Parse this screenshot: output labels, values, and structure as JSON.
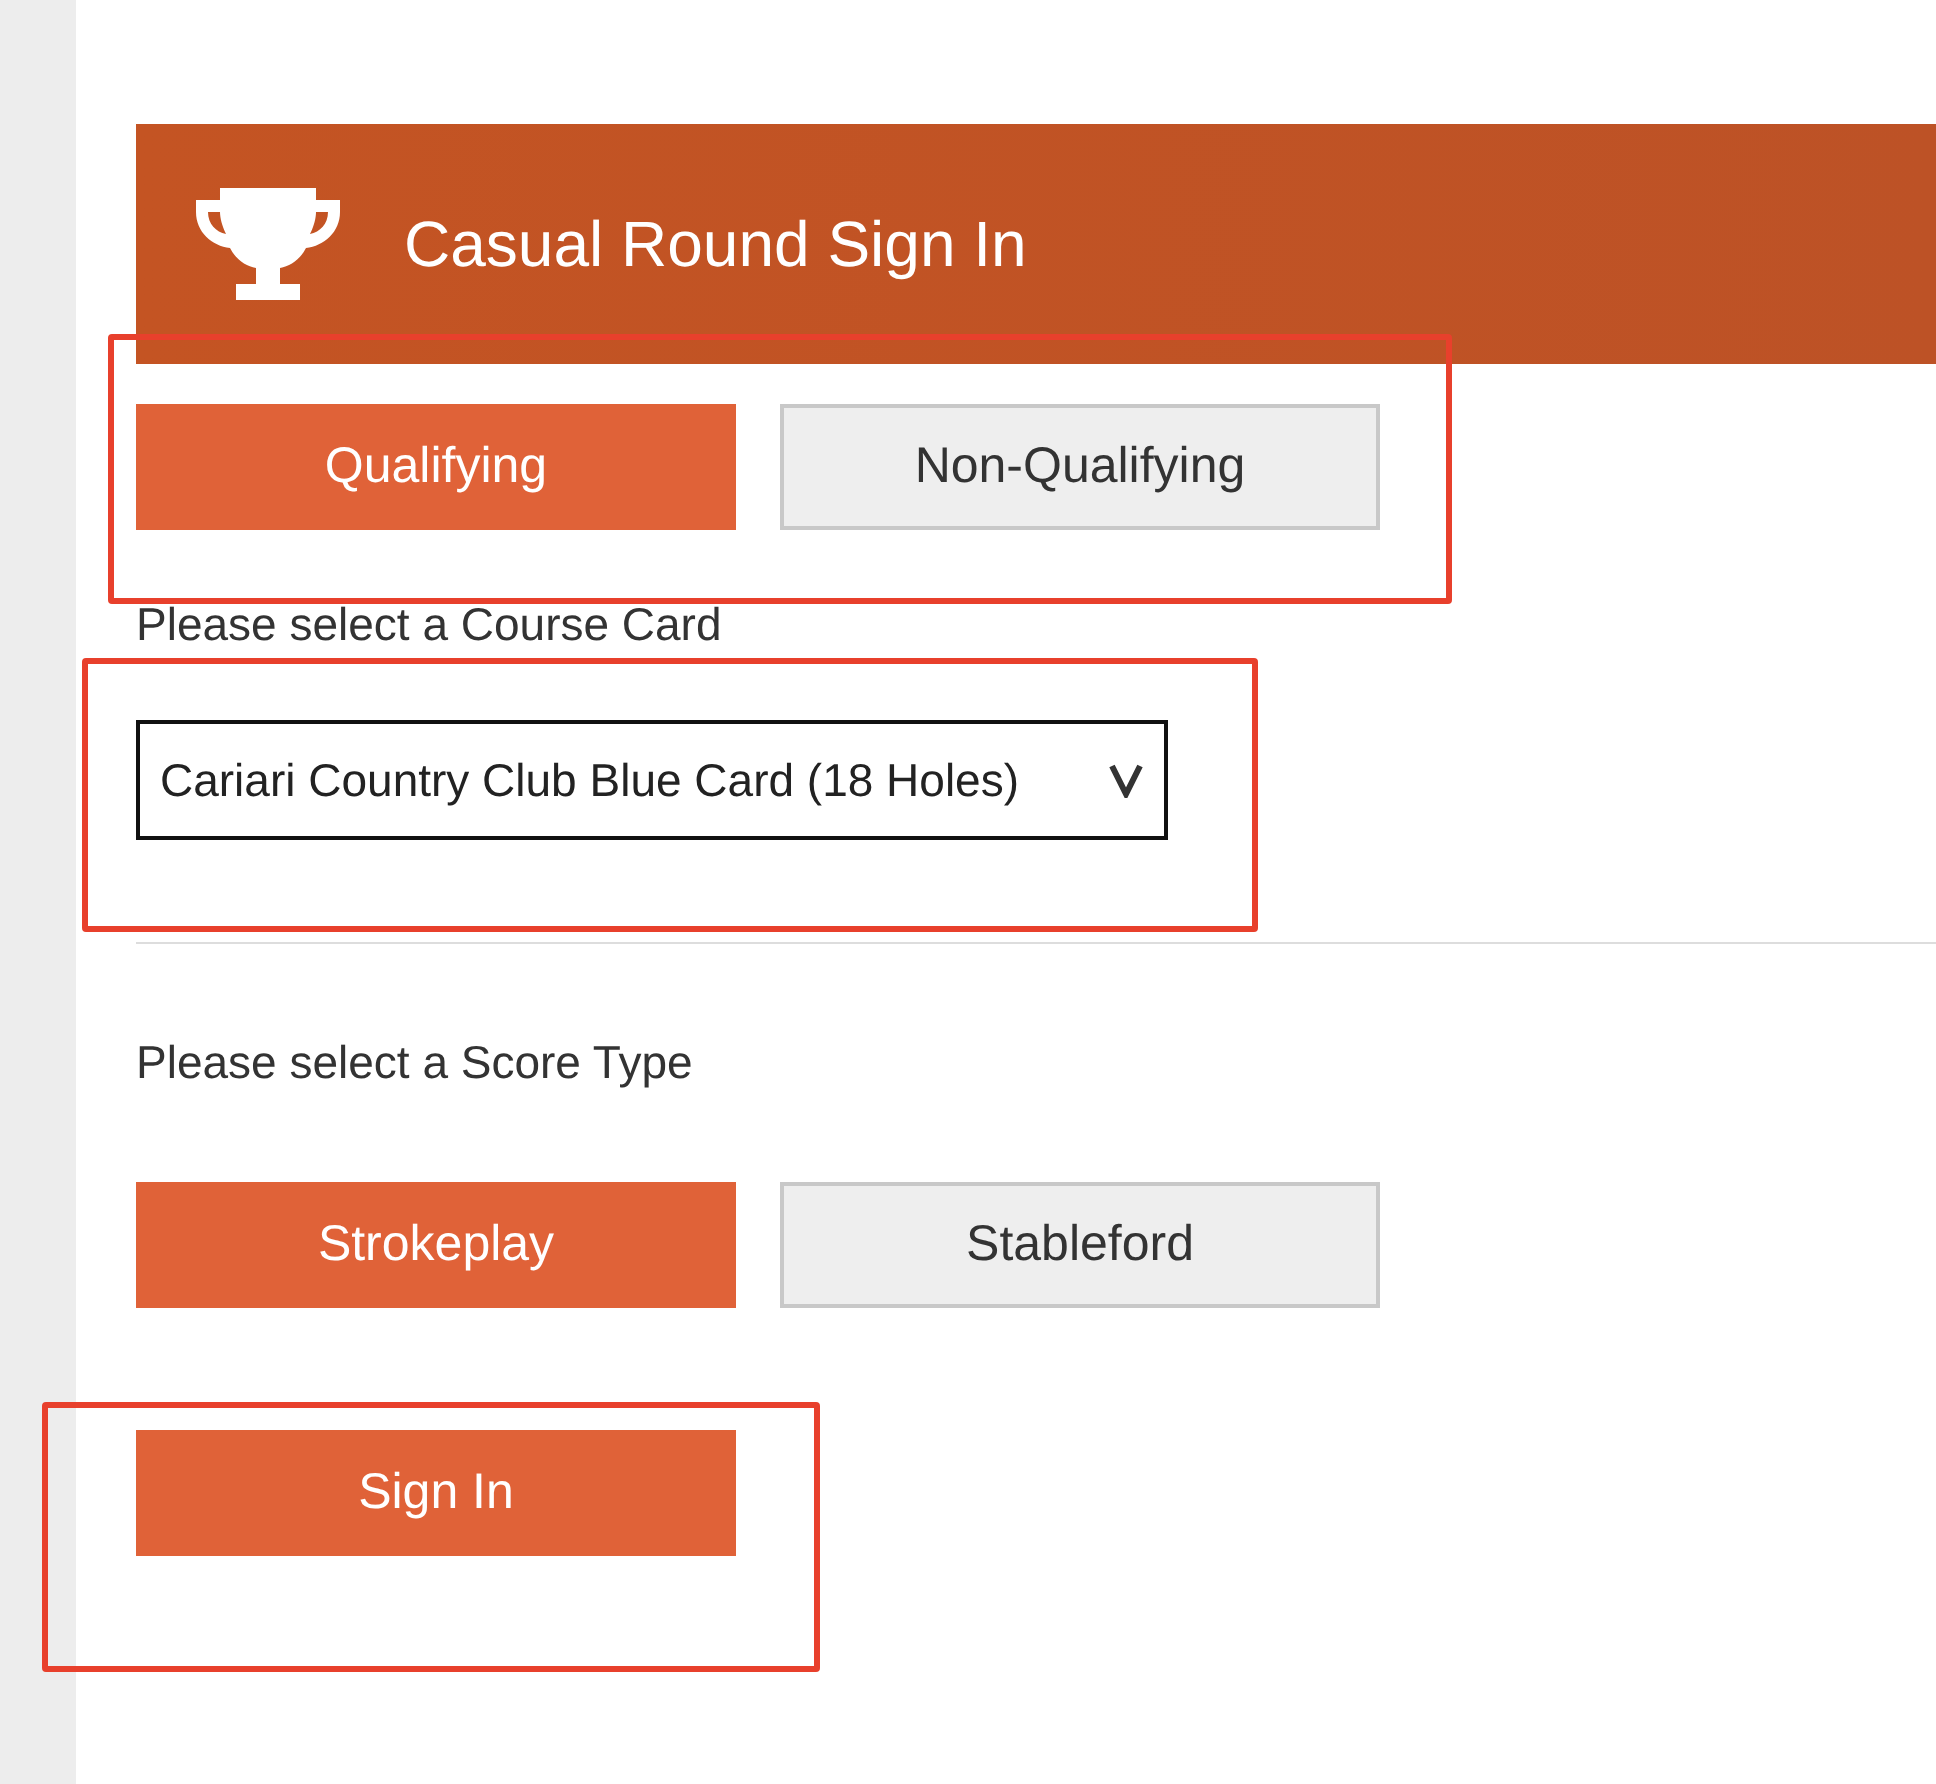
{
  "header": {
    "title": "Casual Round Sign In"
  },
  "round_types": {
    "highlighted": true,
    "options": [
      {
        "label": "Qualifying",
        "selected": true
      },
      {
        "label": "Non-Qualifying",
        "selected": false
      }
    ]
  },
  "course_card": {
    "label": "Please select a Course Card",
    "highlighted": true,
    "value": "Cariari Country Club Blue Card (18 Holes)"
  },
  "score_type": {
    "label": "Please select a Score Type",
    "options": [
      {
        "label": "Strokeplay",
        "selected": true
      },
      {
        "label": "Stableford",
        "selected": false
      }
    ]
  },
  "sign_in": {
    "label": "Sign In",
    "highlighted": true
  }
}
